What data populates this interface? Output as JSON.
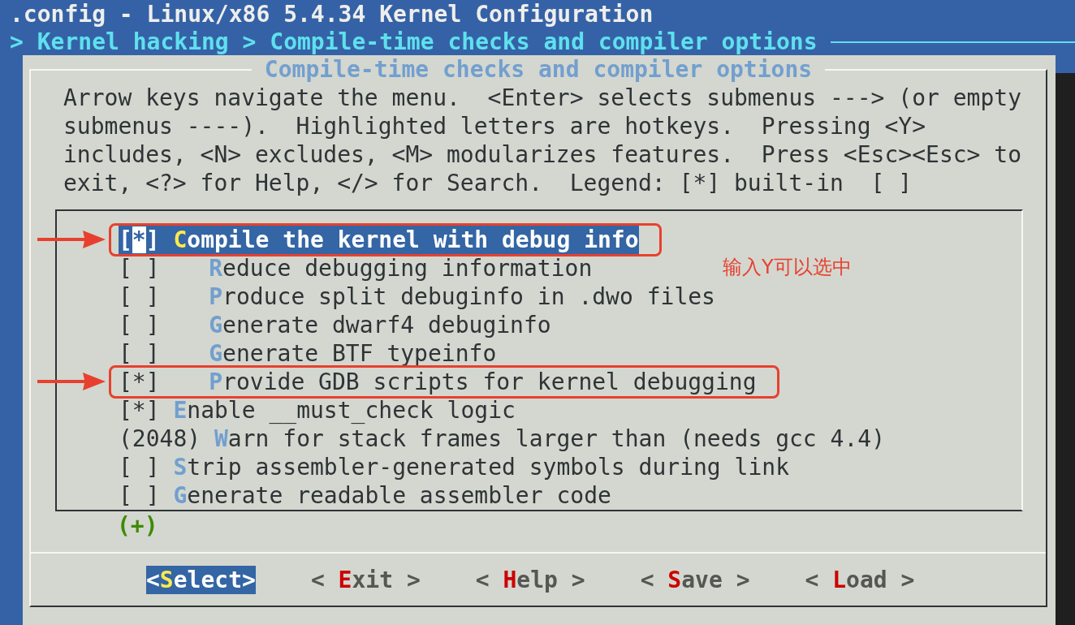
{
  "header": {
    "title": ".config - Linux/x86 5.4.34 Kernel Configuration",
    "breadcrumb": "> Kernel hacking > Compile-time checks and compiler options"
  },
  "dialog": {
    "title": "Compile-time checks and compiler options",
    "help_lines": [
      "Arrow keys navigate the menu.  <Enter> selects submenus ---> (or empty",
      "submenus ----).  Highlighted letters are hotkeys.  Pressing <Y>",
      "includes, <N> excludes, <M> modularizes features.  Press <Esc><Esc> to",
      "exit, <?> for Help, </> for Search.  Legend: [*] built-in  [ ]"
    ]
  },
  "menu": {
    "items": [
      {
        "box": "[*]",
        "hotkey": "C",
        "rest": "ompile the kernel with debug info",
        "selected": true,
        "annotated": true,
        "children": [
          {
            "box": "[ ]",
            "hotkey": "R",
            "rest": "educe debugging information",
            "selected": false,
            "annotated": false
          },
          {
            "box": "[ ]",
            "hotkey": "P",
            "rest": "roduce split debuginfo in .dwo files",
            "selected": false,
            "annotated": false
          },
          {
            "box": "[ ]",
            "hotkey": "G",
            "rest": "enerate dwarf4 debuginfo",
            "selected": false,
            "annotated": false
          },
          {
            "box": "[ ]",
            "hotkey": "G",
            "rest": "enerate BTF typeinfo",
            "selected": false,
            "annotated": false
          },
          {
            "box": "[*]",
            "hotkey": "P",
            "rest": "rovide GDB scripts for kernel debugging",
            "selected": false,
            "annotated": true
          }
        ]
      },
      {
        "box": "[*]",
        "hotkey": "E",
        "rest": "nable __must_check logic",
        "selected": false,
        "annotated": false
      },
      {
        "box": "(2048)",
        "hotkey": "W",
        "rest": "arn for stack frames larger than (needs gcc 4.4)",
        "selected": false,
        "annotated": false
      },
      {
        "box": "[ ]",
        "hotkey": "S",
        "rest": "trip assembler-generated symbols during link",
        "selected": false,
        "annotated": false
      },
      {
        "box": "[ ]",
        "hotkey": "G",
        "rest": "enerate readable assembler code",
        "selected": false,
        "annotated": false
      }
    ],
    "more": "(+)"
  },
  "buttons": [
    {
      "prefix": "<",
      "hotkey": "S",
      "suffix": "elect>",
      "selected": true
    },
    {
      "prefix": "< ",
      "hotkey": "E",
      "suffix": "xit >",
      "selected": false
    },
    {
      "prefix": "< ",
      "hotkey": "H",
      "suffix": "elp >",
      "selected": false
    },
    {
      "prefix": "< ",
      "hotkey": "S",
      "suffix": "ave >",
      "selected": false
    },
    {
      "prefix": "< ",
      "hotkey": "L",
      "suffix": "oad >",
      "selected": false
    }
  ],
  "annotation": {
    "note": "输入Y可以选中"
  }
}
